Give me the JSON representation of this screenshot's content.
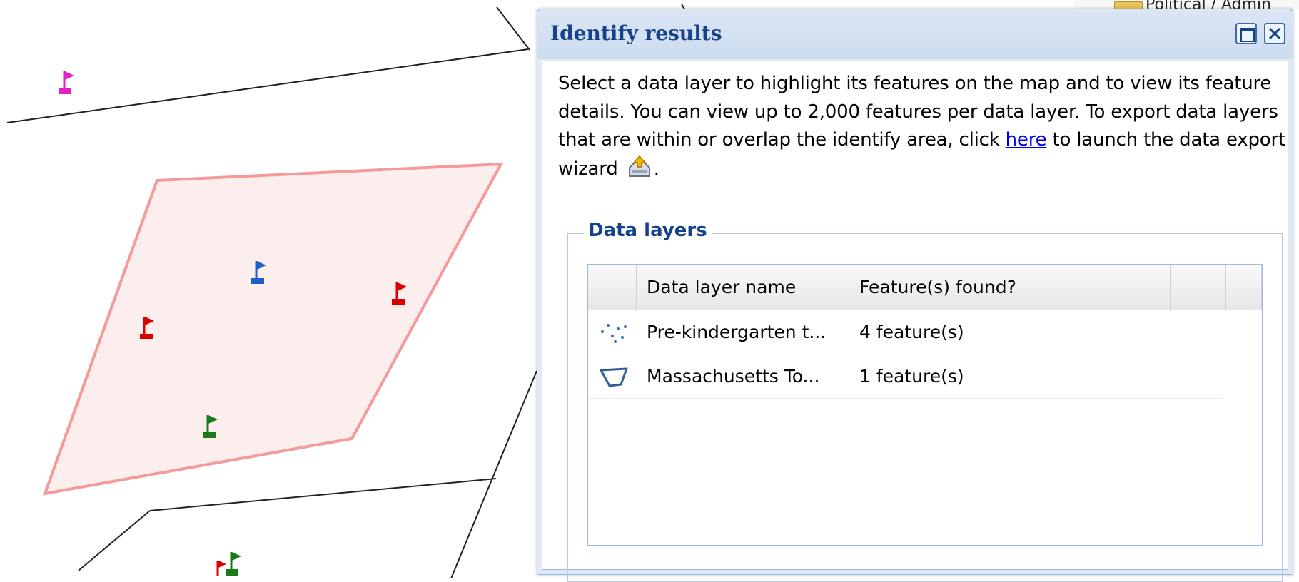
{
  "dialog": {
    "title": "Identify results",
    "maximize_icon": "maximize-icon",
    "close_icon": "close-icon",
    "description": {
      "text_before_link": "Select a data layer to highlight its features on the map and to view its feature details. You can view up to 2,000 features per data layer. To export data layers that are within or overlap the identify area, click ",
      "link_text": "here",
      "text_after_link": " to launch the data export wizard",
      "icon": "export-wizard-icon",
      "text_end": "."
    },
    "data_layers": {
      "legend": "Data layers",
      "columns": [
        "",
        "Data layer name",
        "Feature(s) found?",
        "",
        ""
      ],
      "rows": [
        {
          "icon": "point-layer-icon",
          "name": "Pre-kindergarten t...",
          "found": "4 feature(s)"
        },
        {
          "icon": "polygon-layer-icon",
          "name": "Massachusetts To...",
          "found": "1 feature(s)"
        }
      ]
    }
  },
  "tree_fragment": {
    "label": "Political / Admin",
    "icon": "folder-icon"
  },
  "map": {
    "highlight_fill": "#fdeeee",
    "highlight_stroke": "#f59a9a",
    "marker_colors": {
      "magenta": "#e020c8",
      "blue": "#1f5fc8",
      "red": "#d80000",
      "green": "#1a7a1a"
    }
  }
}
